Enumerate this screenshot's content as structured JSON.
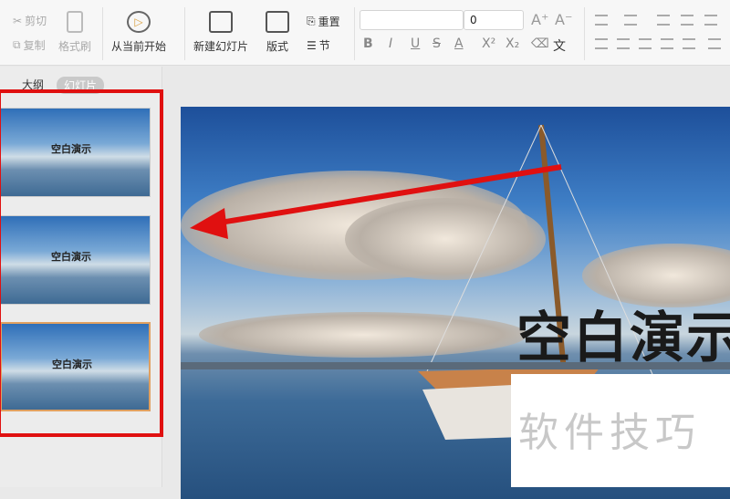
{
  "toolbar": {
    "cut": "剪切",
    "copy": "复制",
    "format_painter": "格式刷",
    "play_from_current": "从当前开始",
    "new_slide": "新建幻灯片",
    "layout": "版式",
    "reset": "重置",
    "section": "节",
    "font_name": "",
    "font_size": "0",
    "format_buttons": [
      "B",
      "I",
      "U",
      "S",
      "A",
      "X²",
      "X₂"
    ]
  },
  "panel": {
    "tabs": [
      "大纲",
      "幻灯片"
    ],
    "thumbnails": [
      {
        "title": "空白演示"
      },
      {
        "title": "空白演示"
      },
      {
        "title": "空白演示"
      }
    ]
  },
  "slide": {
    "title": "空白演示"
  },
  "watermark": "软件技巧",
  "colors": {
    "annotation": "#e01010",
    "accent": "#e0a060"
  }
}
